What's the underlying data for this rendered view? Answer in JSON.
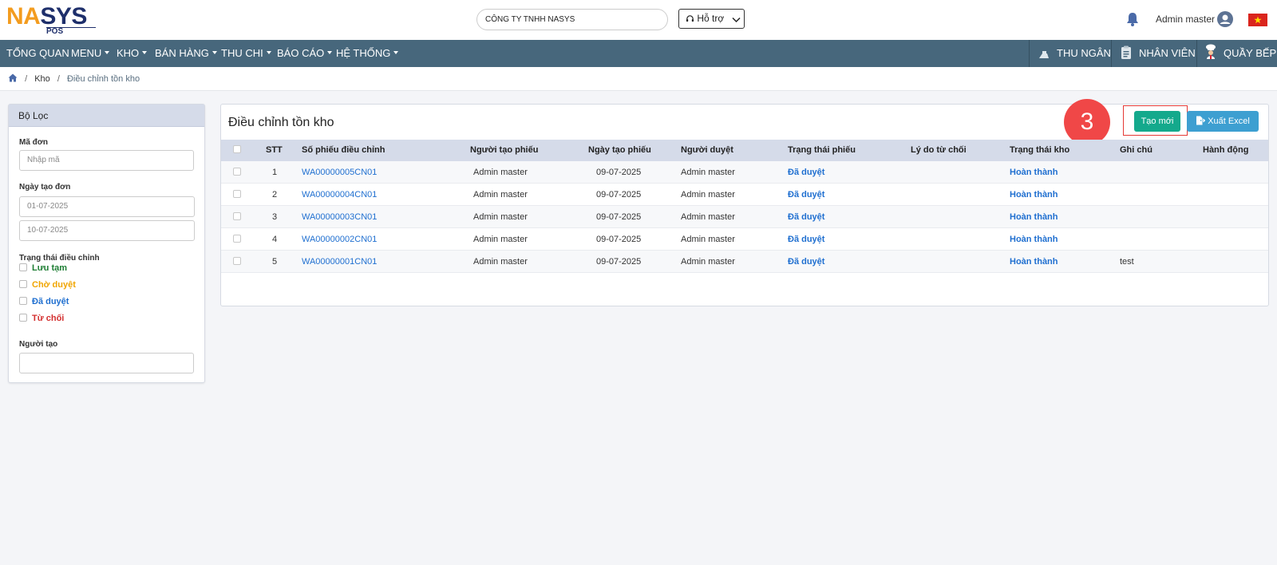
{
  "header": {
    "logo": {
      "left": "NA",
      "mid": "S",
      "right": "YS",
      "sub": "POS"
    },
    "company": "CÔNG TY TNHH NASYS",
    "support_label": "Hỗ trợ",
    "user_name": "Admin master",
    "flag": "vietnam-flag"
  },
  "nav": {
    "items": [
      {
        "label": "TỔNG QUAN"
      },
      {
        "label": "MENU"
      },
      {
        "label": "KHO"
      },
      {
        "label": "BÁN HÀNG"
      },
      {
        "label": "THU CHI"
      },
      {
        "label": "BÁO CÁO"
      },
      {
        "label": "HỆ THỐNG"
      }
    ],
    "right": [
      {
        "label": "THU NGÂN",
        "icon": "cashier-icon"
      },
      {
        "label": "NHÂN VIÊN",
        "icon": "staff-icon"
      },
      {
        "label": "QUẦY BẾP",
        "icon": "chef-icon"
      }
    ]
  },
  "breadcrumb": {
    "level1": "Kho",
    "current": "Điều chỉnh tồn kho"
  },
  "filter": {
    "title": "Bộ Lọc",
    "code_label": "Mã đơn",
    "code_placeholder": "Nhập mã",
    "date_label": "Ngày tạo đơn",
    "date_from": "01-07-2025",
    "date_to": "10-07-2025",
    "status_label": "Trạng thái điều chỉnh",
    "statuses": [
      {
        "label": "Lưu tạm",
        "color": "#1e7e34"
      },
      {
        "label": "Chờ duyệt",
        "color": "#f0a500"
      },
      {
        "label": "Đã duyệt",
        "color": "#1f6fd0"
      },
      {
        "label": "Từ chối",
        "color": "#d32f2f"
      }
    ],
    "creator_label": "Người tạo"
  },
  "main": {
    "title": "Điều chỉnh tồn kho",
    "step_number": "3",
    "new_button": "Tạo mới",
    "excel_button": "Xuất Excel",
    "columns": [
      "STT",
      "Số phiếu điều chỉnh",
      "Người tạo phiếu",
      "Ngày tạo phiếu",
      "Người duyệt",
      "Trạng thái phiếu",
      "Lý do từ chối",
      "Trạng thái kho",
      "Ghi chú",
      "Hành động"
    ],
    "rows": [
      {
        "stt": "1",
        "code": "WA00000005CN01",
        "creator": "Admin master",
        "date": "09-07-2025",
        "approver": "Admin master",
        "status": "Đã duyệt",
        "reason": "",
        "stock_status": "Hoàn thành",
        "note": ""
      },
      {
        "stt": "2",
        "code": "WA00000004CN01",
        "creator": "Admin master",
        "date": "09-07-2025",
        "approver": "Admin master",
        "status": "Đã duyệt",
        "reason": "",
        "stock_status": "Hoàn thành",
        "note": ""
      },
      {
        "stt": "3",
        "code": "WA00000003CN01",
        "creator": "Admin master",
        "date": "09-07-2025",
        "approver": "Admin master",
        "status": "Đã duyệt",
        "reason": "",
        "stock_status": "Hoàn thành",
        "note": ""
      },
      {
        "stt": "4",
        "code": "WA00000002CN01",
        "creator": "Admin master",
        "date": "09-07-2025",
        "approver": "Admin master",
        "status": "Đã duyệt",
        "reason": "",
        "stock_status": "Hoàn thành",
        "note": ""
      },
      {
        "stt": "5",
        "code": "WA00000001CN01",
        "creator": "Admin master",
        "date": "09-07-2025",
        "approver": "Admin master",
        "status": "Đã duyệt",
        "reason": "",
        "stock_status": "Hoàn thành",
        "note": "test"
      }
    ]
  },
  "colors": {
    "nav_bg": "#47677c",
    "header_band": "#d5dbe9",
    "primary_green": "#14a98c",
    "excel_blue": "#3d9fd1",
    "link_blue": "#1f6fd0",
    "badge_red": "#f04747"
  }
}
